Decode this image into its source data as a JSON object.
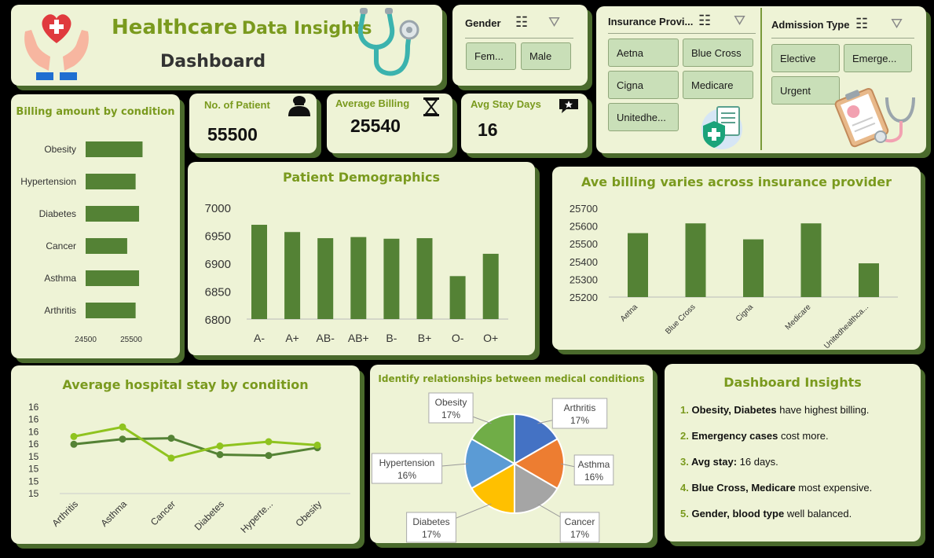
{
  "header": {
    "title_main": "Healthcare",
    "title_rest": "Data Insights",
    "subtitle": "Dashboard"
  },
  "slicers": {
    "gender": {
      "label": "Gender",
      "options": [
        "Fem...",
        "Male"
      ]
    },
    "insurance": {
      "label": "Insurance Provi...",
      "options": [
        "Aetna",
        "Blue Cross",
        "Cigna",
        "Medicare",
        "Unitedhe..."
      ]
    },
    "admission": {
      "label": "Admission Type",
      "options": [
        "Elective",
        "Emerge...",
        "Urgent"
      ]
    }
  },
  "kpis": {
    "patients": {
      "label": "No. of Patient",
      "value": "55500"
    },
    "billing": {
      "label": "Average Billing",
      "value": "25540"
    },
    "stay": {
      "label": "Avg  Stay Days",
      "value": "16"
    }
  },
  "colors": {
    "panel": "#eef3d6",
    "shadow": "#4a6a2c",
    "bar": "#548235",
    "title": "#7a9a1e",
    "line_light": "#8fc31f",
    "line_dark": "#548235"
  },
  "chart_data": [
    {
      "type": "bar",
      "orientation": "horizontal",
      "title": "Billing amount by condition",
      "categories": [
        "Obesity",
        "Hypertension",
        "Diabetes",
        "Cancer",
        "Asthma",
        "Arthritis"
      ],
      "values": [
        25650,
        25510,
        25580,
        25340,
        25580,
        25510
      ],
      "xlim": [
        24500,
        26000
      ],
      "xticks": [
        "24500",
        "25500"
      ]
    },
    {
      "type": "bar",
      "title": "Patient Demographics",
      "categories": [
        "A-",
        "A+",
        "AB-",
        "AB+",
        "B-",
        "B+",
        "O-",
        "O+"
      ],
      "values": [
        6969,
        6956,
        6945,
        6947,
        6944,
        6945,
        6877,
        6917
      ],
      "ylim": [
        6800,
        7000
      ],
      "yticks": [
        "7000",
        "6950",
        "6900",
        "6850",
        "6800"
      ]
    },
    {
      "type": "bar",
      "title": "Ave billing varies across insurance provider",
      "categories": [
        "Aetna",
        "Blue Cross",
        "Cigna",
        "Medicare",
        "Unitedhealthca..."
      ],
      "values": [
        25560,
        25615,
        25525,
        25615,
        25390
      ],
      "ylim": [
        25200,
        25700
      ],
      "yticks": [
        "25700",
        "25600",
        "25500",
        "25400",
        "25300",
        "25200"
      ]
    },
    {
      "type": "line",
      "title": "Average hospital stay by condition",
      "categories": [
        "Arthritis",
        "Asthma",
        "Cancer",
        "Diabetes",
        "Hyperte...",
        "Obesity"
      ],
      "series": [
        {
          "values": [
            15.57,
            15.63,
            15.64,
            15.45,
            15.44,
            15.53
          ]
        },
        {
          "values": [
            15.66,
            15.77,
            15.41,
            15.55,
            15.6,
            15.56
          ]
        }
      ],
      "ylim": [
        15.0,
        16.0
      ],
      "yticks": [
        "16",
        "16",
        "16",
        "16",
        "15",
        "15",
        "15",
        "15"
      ]
    },
    {
      "type": "pie",
      "title": "Identify relationships between medical conditions",
      "categories": [
        "Arthritis",
        "Asthma",
        "Cancer",
        "Diabetes",
        "Hypertension",
        "Obesity"
      ],
      "values": [
        16.68,
        16.68,
        16.66,
        16.67,
        16.65,
        16.66
      ],
      "labels": [
        "17%",
        "16%",
        "17%",
        "17%",
        "16%",
        "17%"
      ],
      "colors": [
        "#4472c4",
        "#ed7d31",
        "#a5a5a5",
        "#ffc000",
        "#5b9bd5",
        "#70ad47"
      ]
    }
  ],
  "insights": {
    "title": "Dashboard Insights",
    "items": [
      {
        "num": "1.",
        "bold": "Obesity, Diabetes",
        "text": " have highest billing."
      },
      {
        "num": "2.",
        "bold": "Emergency cases",
        "text": " cost more."
      },
      {
        "num": "3.",
        "bold": "Avg stay:",
        "text": " 16 days."
      },
      {
        "num": "4.",
        "bold": "Blue Cross, Medicare",
        "text": " most expensive."
      },
      {
        "num": "5.",
        "bold": "Gender, blood type",
        "text": " well balanced."
      }
    ]
  }
}
